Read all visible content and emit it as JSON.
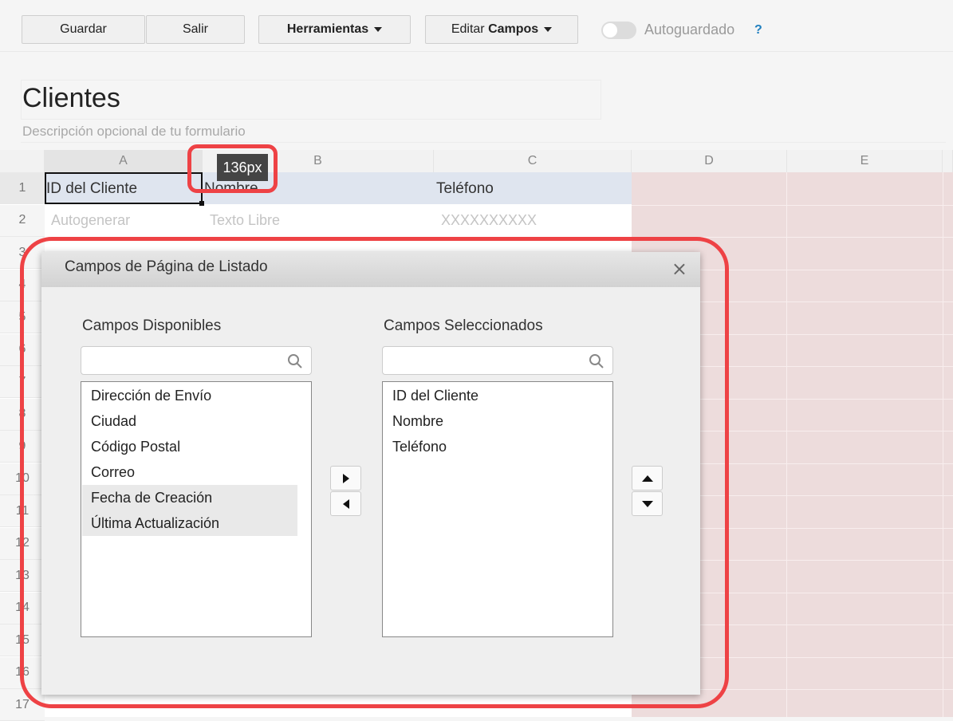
{
  "toolbar": {
    "save_label": "Guardar",
    "exit_label": "Salir",
    "tools_label": "Herramientas",
    "edit_label_prefix": "Editar",
    "edit_label_bold": "Campos",
    "autosave_label": "Autoguardado",
    "autosave_on": false,
    "help_label": "?"
  },
  "form": {
    "title": "Clientes",
    "description_placeholder": "Descripción opcional de tu formulario"
  },
  "sheet": {
    "columns": [
      "A",
      "B",
      "C",
      "D",
      "E"
    ],
    "rows": [
      "1",
      "2",
      "3",
      "4",
      "5",
      "6",
      "7",
      "8",
      "9",
      "10",
      "11",
      "12",
      "13",
      "14",
      "15",
      "16",
      "17"
    ],
    "row1": [
      "ID del Cliente",
      "Nombre",
      "Teléfono"
    ],
    "row2": [
      "Autogenerar",
      "Texto Libre",
      "XXXXXXXXXX"
    ],
    "column_width_tooltip": "136px"
  },
  "dialog": {
    "title": "Campos de Página de Listado",
    "available_label": "Campos Disponibles",
    "selected_label": "Campos Seleccionados",
    "available_fields": [
      "Dirección de Envío",
      "Ciudad",
      "Código Postal",
      "Correo",
      "Fecha de Creación",
      "Última Actualización"
    ],
    "selected_fields": [
      "ID del Cliente",
      "Nombre",
      "Teléfono"
    ]
  },
  "colors": {
    "highlight": "#ee4245",
    "unused_columns": "#eddcdc",
    "header_row": "#dfe5ef"
  }
}
